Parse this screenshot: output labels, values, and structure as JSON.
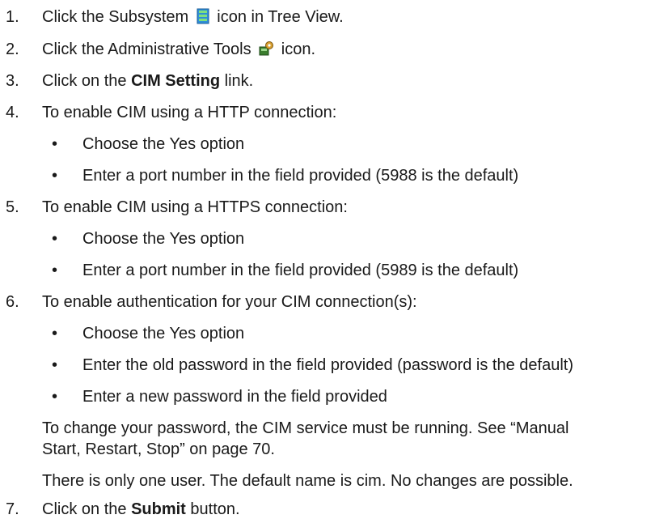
{
  "steps": [
    {
      "num": "1.",
      "before": "Click the Subsystem",
      "icon": "subsystem-icon",
      "after": "icon in Tree View."
    },
    {
      "num": "2.",
      "before": "Click the Administrative Tools",
      "icon": "administrative-tools-icon",
      "after": "icon."
    },
    {
      "num": "3.",
      "before": "Click on the",
      "bold": "CIM Setting",
      "after": "link."
    },
    {
      "num": "4.",
      "text": "To enable CIM using a HTTP connection:",
      "bullets": [
        "Choose the Yes option",
        "Enter a port number in the field provided (5988 is the default)"
      ]
    },
    {
      "num": "5.",
      "text": "To enable CIM using a HTTPS connection:",
      "bullets": [
        "Choose the Yes option",
        "Enter a port number in the field provided (5989 is the default)"
      ]
    },
    {
      "num": "6.",
      "text": "To enable authentication for your CIM connection(s):",
      "bullets": [
        "Choose the Yes option",
        "Enter the old password in the field provided (password is the default)",
        "Enter a new password in the field provided"
      ]
    },
    {
      "num": "7.",
      "before": "Click on the",
      "bold": "Submit",
      "after": "button."
    }
  ],
  "bullet_char": "•",
  "notes": {
    "password_note_line1": "To change your password, the CIM service must be running. See “Manual",
    "password_note_line2": "Start, Restart, Stop” on page 70.",
    "user_note": "There is only one user. The default name is cim. No changes are possible."
  }
}
